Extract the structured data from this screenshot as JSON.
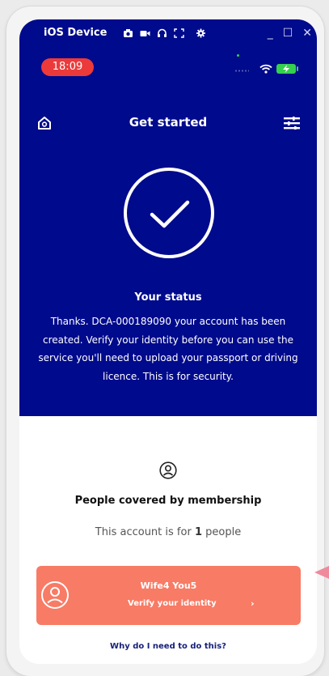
{
  "emulator": {
    "title": "iOS Device",
    "icons": [
      "camera-icon",
      "video-icon",
      "headphones-icon",
      "fullscreen-icon",
      "settings-icon"
    ],
    "window_controls": {
      "minimize": "_",
      "maximize": "☐",
      "close": "✕"
    }
  },
  "status_bar": {
    "time": "18:09",
    "time_pill_color": "#ec3a3a",
    "battery_color": "#36d04f"
  },
  "header": {
    "title": "Get started",
    "left_icon": "home-icon",
    "right_icon": "menu-icon",
    "background_color": "#000a8c"
  },
  "status": {
    "icon": "check-circle-icon",
    "title": "Your status",
    "message": "Thanks. DCA-000189090 your account has been created. Verify your identity before you can use the service you'll need to upload your passport or driving licence. This is for security."
  },
  "membership": {
    "icon": "person-icon",
    "title": "People covered by membership",
    "account_prefix": "This account is for",
    "people_count": "1",
    "account_suffix": "people"
  },
  "verify_card": {
    "name": "Wife4 You5",
    "action": "Verify your identity",
    "chevron": "›",
    "color": "#f87b65"
  },
  "why_link": "Why do I need to do this?"
}
